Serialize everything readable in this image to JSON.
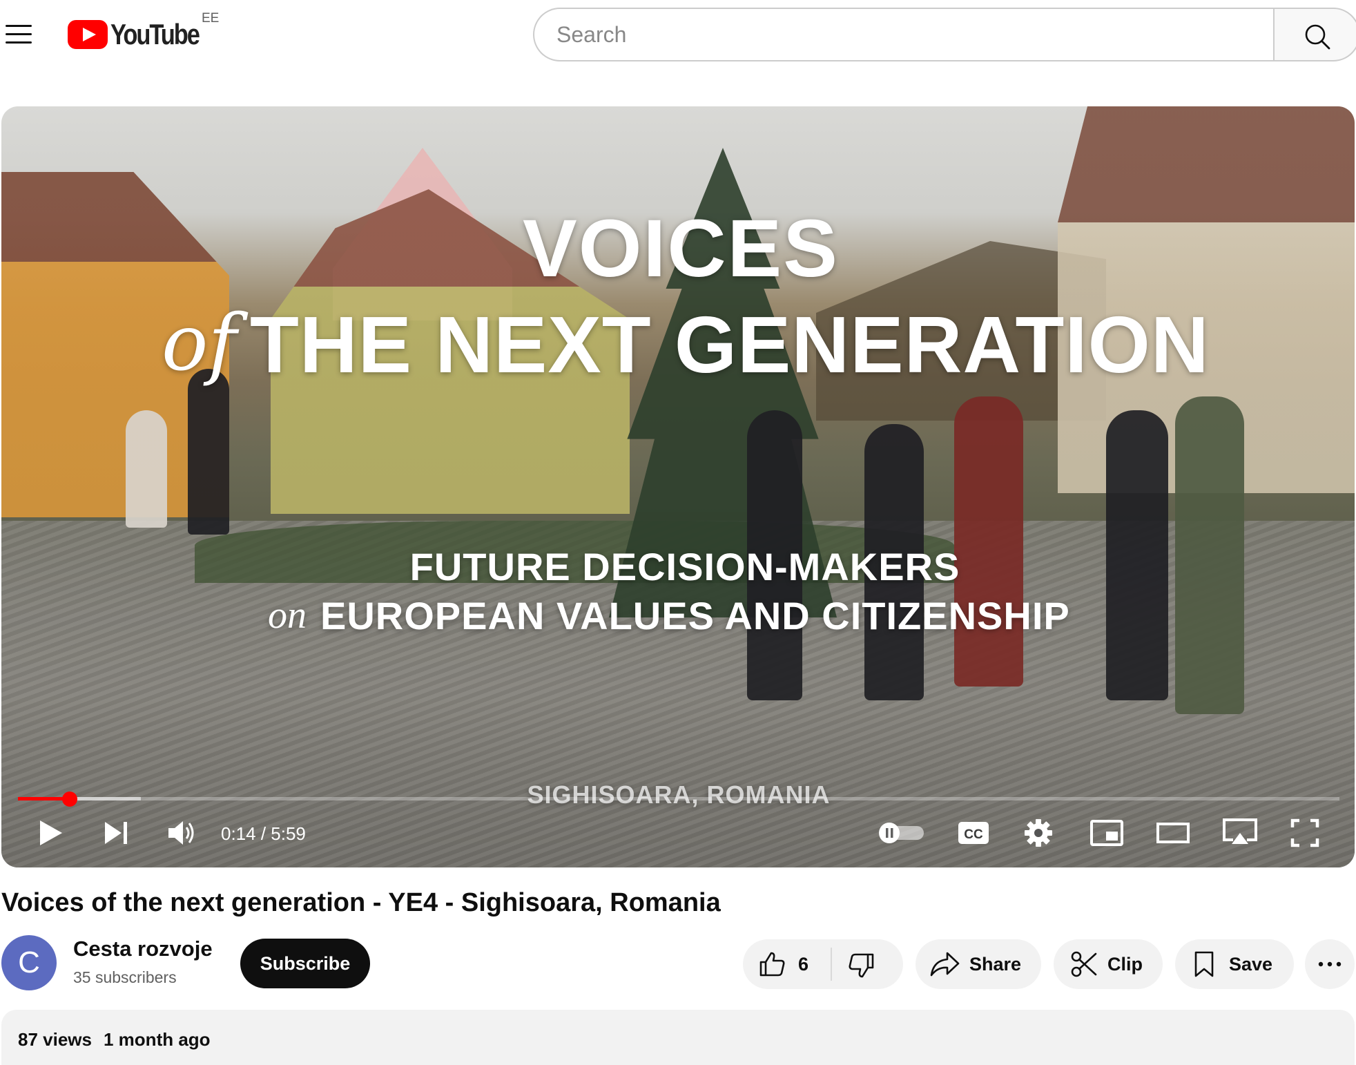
{
  "masthead": {
    "logo_text": "YouTube",
    "region_code": "EE",
    "search_placeholder": "Search",
    "search_value": "",
    "menu_icon": "hamburger-menu-icon",
    "search_icon": "search-icon"
  },
  "player": {
    "title_card": {
      "line1": "VOICES",
      "line2_script": "of",
      "line2": "THE NEXT GENERATION",
      "line3": "FUTURE DECISION-MAKERS",
      "line4_script": "on",
      "line4": "EUROPEAN VALUES AND CITIZENSHIP",
      "location": "SIGHISOARA, ROMANIA"
    },
    "time_current": "0:14",
    "time_separator": " / ",
    "time_total": "5:59",
    "progress_played_fraction": 0.039,
    "progress_buffered_fraction": 0.093,
    "autoplay_on": false,
    "captions_label": "CC",
    "controls": {
      "play": "play-icon",
      "next": "next-icon",
      "volume": "volume-icon",
      "autoplay": "autoplay-toggle-icon",
      "captions": "captions-icon",
      "settings": "gear-icon",
      "miniplayer": "miniplayer-icon",
      "theater": "theater-mode-icon",
      "cast": "cast-icon",
      "fullscreen": "fullscreen-icon"
    }
  },
  "video": {
    "title": "Voices of the next generation - YE4 - Sighisoara, Romania",
    "channel": {
      "avatar_letter": "C",
      "avatar_color": "#5c6bc0",
      "name": "Cesta rozvoje",
      "subscribers": "35 subscribers",
      "subscribe_label": "Subscribe"
    },
    "actions": {
      "like_count": "6",
      "share_label": "Share",
      "clip_label": "Clip",
      "save_label": "Save"
    },
    "description": {
      "views": "87 views",
      "age": "1 month ago"
    }
  },
  "colors": {
    "brand_red": "#ff0000",
    "text_primary": "#0f0f0f",
    "text_secondary": "#606060",
    "pill_bg": "#f2f2f2"
  }
}
